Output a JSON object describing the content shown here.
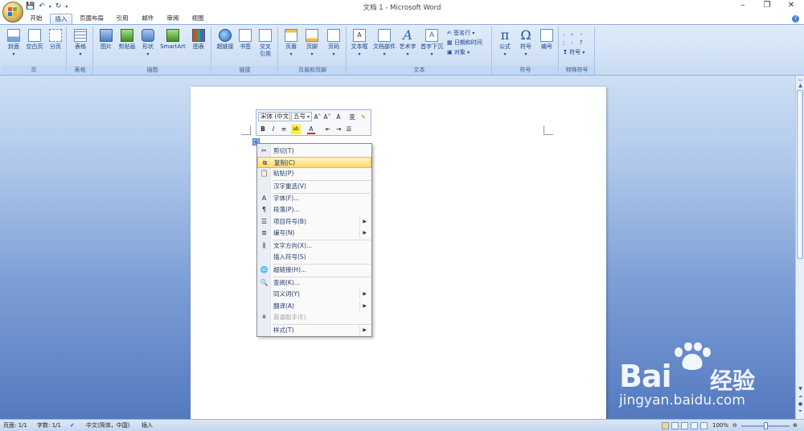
{
  "window": {
    "title": "文档 1 - Microsoft Word",
    "controls": [
      "–",
      "❐",
      "✕"
    ]
  },
  "qat": {
    "save_icon": "save-icon",
    "undo_icon": "undo-icon",
    "redo_icon": "redo-icon",
    "customize_icon": "customize-icon"
  },
  "tabs": [
    "开始",
    "插入",
    "页面布局",
    "引用",
    "邮件",
    "审阅",
    "视图"
  ],
  "active_tab": "插入",
  "ribbon": {
    "groups": {
      "pages": "页",
      "tables": "表格",
      "illustrations": "插图",
      "links": "链接",
      "header_footer": "页眉和页脚",
      "text": "文本",
      "symbols": "符号",
      "special_symbols": "特殊符号"
    },
    "buttons": {
      "cover": "封面",
      "blank_page": "空白页",
      "page_break": "分页",
      "table": "表格",
      "picture": "图片",
      "clipart": "剪贴画",
      "shapes": "形状",
      "smartart": "SmartArt",
      "chart": "图表",
      "hyperlink": "超链接",
      "bookmark": "书签",
      "crossref_line1": "交叉",
      "crossref_line2": "引用",
      "header": "页眉",
      "footer": "页脚",
      "page_number": "页码",
      "textbox": "文本框",
      "quick_parts": "文档部件",
      "wordart": "艺术字",
      "dropcap": "首字下沉",
      "signature_line": "签名行",
      "date_time": "日期和时间",
      "object": "对象",
      "equation": "公式",
      "symbol": "符号",
      "numbering": "编号",
      "special_symbol": "符号"
    }
  },
  "mini_toolbar": {
    "font": "宋体 (中文",
    "size": "五号",
    "row1_icons": [
      "A˄",
      "A˅",
      "A",
      "变",
      "✎"
    ],
    "row2_icons": [
      "B",
      "I",
      "≡",
      "ab",
      "A",
      "⇤",
      "⇥",
      "☰"
    ]
  },
  "context_menu": {
    "items": [
      {
        "label": "剪切(T)",
        "icon": "✂",
        "highlight": false,
        "submenu": false,
        "disabled": false
      },
      {
        "label": "复制(C)",
        "icon": "⧉",
        "highlight": true,
        "submenu": false,
        "disabled": false
      },
      {
        "label": "粘贴(P)",
        "icon": "📋",
        "highlight": false,
        "submenu": false,
        "disabled": false
      },
      {
        "label": "汉字重选(V)",
        "icon": "",
        "highlight": false,
        "submenu": false,
        "disabled": false
      },
      {
        "label": "字体(F)...",
        "icon": "A",
        "highlight": false,
        "submenu": false,
        "disabled": false
      },
      {
        "label": "段落(P)...",
        "icon": "¶",
        "highlight": false,
        "submenu": false,
        "disabled": false
      },
      {
        "label": "项目符号(B)",
        "icon": "☰",
        "highlight": false,
        "submenu": true,
        "disabled": false
      },
      {
        "label": "编号(N)",
        "icon": "≣",
        "highlight": false,
        "submenu": true,
        "disabled": false
      },
      {
        "label": "文字方向(X)...",
        "icon": "⫼",
        "highlight": false,
        "submenu": false,
        "disabled": false
      },
      {
        "label": "插入符号(S)",
        "icon": "",
        "highlight": false,
        "submenu": false,
        "disabled": false
      },
      {
        "label": "超链接(H)...",
        "icon": "🌐",
        "highlight": false,
        "submenu": false,
        "disabled": false
      },
      {
        "label": "查阅(K)...",
        "icon": "🔍",
        "highlight": false,
        "submenu": false,
        "disabled": false
      },
      {
        "label": "同义词(Y)",
        "icon": "",
        "highlight": false,
        "submenu": true,
        "disabled": false
      },
      {
        "label": "翻译(A)",
        "icon": "",
        "highlight": false,
        "submenu": true,
        "disabled": false
      },
      {
        "label": "英语助手(E)",
        "icon": "⚘",
        "highlight": false,
        "submenu": false,
        "disabled": true
      },
      {
        "label": "样式(T)",
        "icon": "",
        "highlight": false,
        "submenu": true,
        "disabled": false
      }
    ]
  },
  "statusbar": {
    "page": "页面: 1/1",
    "words": "字数: 1/1",
    "language": "中文(简体，中国)",
    "mode": "插入",
    "zoom": "100%"
  },
  "watermark": {
    "brand": "Bai",
    "brand_cn": "经验",
    "url": "jingyan.baidu.com"
  },
  "colors": {
    "ribbon_bg": "#c8dbf3",
    "highlight": "#ffd96b",
    "doc_bg": "#5479c0"
  }
}
